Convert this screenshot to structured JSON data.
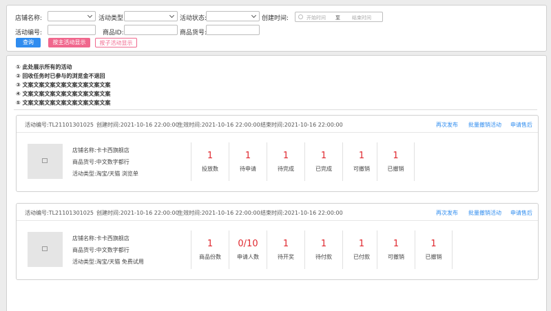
{
  "filters": {
    "shop_name_label": "店铺名称:",
    "activity_type_label": "活动类型:",
    "activity_status_label": "活动状态:",
    "create_time_label": "创建时间:",
    "start_time_placeholder": "开始时间",
    "range_separator": "至",
    "end_time_placeholder": "结束时间",
    "activity_no_label": "活动编号:",
    "product_id_label": "商品ID:",
    "product_code_label": "商品货号:"
  },
  "buttons": {
    "query": "查询",
    "by_main": "按主活动显示",
    "by_sub": "按子活动显示"
  },
  "notes": [
    "① 此处展示所有的活动",
    "② 回收任务时已参与的浏览金不退回",
    "③ 文案文案文案文案文案文案文案文案",
    "④ 文案文案文案文案文案文案文案文案",
    "⑤ 文案文案文案文案文案文案文案文案"
  ],
  "cards": [
    {
      "activity_no": "活动编号:TL21101301025",
      "created": "创建时间:2021-10-16 22:00:00",
      "effective": "生效时间:2021-10-16 22:00:00",
      "ended": "结束时间:2021-10-16 22:00:00",
      "actions": [
        "再次发布",
        "批量撤销活动",
        "申请售后"
      ],
      "shop": "店铺名称:卡卡西旗舰店",
      "product_code": "商品货号:中文数字都行",
      "activity_type": "活动类型:淘宝/天猫 浏览单",
      "stats": [
        {
          "value": "1",
          "label": "投放数"
        },
        {
          "value": "1",
          "label": "待申请"
        },
        {
          "value": "1",
          "label": "待完成"
        },
        {
          "value": "1",
          "label": "已完成"
        },
        {
          "value": "1",
          "label": "可撤销"
        },
        {
          "value": "1",
          "label": "已撤销"
        }
      ]
    },
    {
      "activity_no": "活动编号:TL21101301025",
      "created": "创建时间:2021-10-16 22:00:00",
      "effective": "生效时间:2021-10-16 22:00:00",
      "ended": "结束时间:2021-10-16 22:00:00",
      "actions": [
        "再次发布",
        "批量撤销活动",
        "申请售后"
      ],
      "shop": "店铺名称:卡卡西旗舰店",
      "product_code": "商品货号:中文数字都行",
      "activity_type": "活动类型:淘宝/天猫 免费试用",
      "stats": [
        {
          "value": "1",
          "label": "商品份数"
        },
        {
          "value": "0/10",
          "label": "申请人数"
        },
        {
          "value": "1",
          "label": "待开奖"
        },
        {
          "value": "1",
          "label": "待付款"
        },
        {
          "value": "1",
          "label": "已付款"
        },
        {
          "value": "1",
          "label": "可撤销"
        },
        {
          "value": "1",
          "label": "已撤销"
        }
      ]
    }
  ],
  "colors": {
    "primary": "#2f8cef",
    "accent": "#f0678d",
    "stat_number": "#e0282e"
  }
}
